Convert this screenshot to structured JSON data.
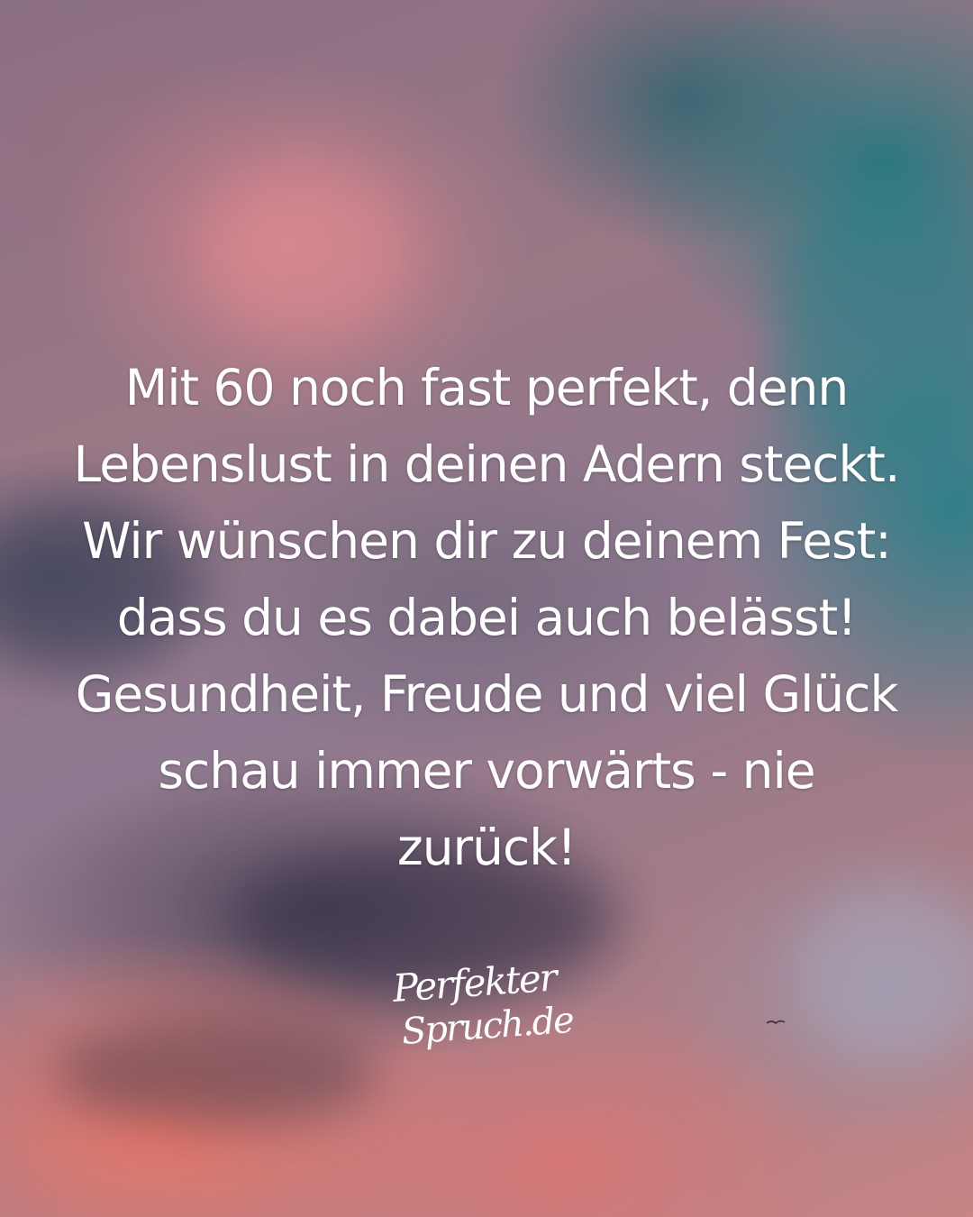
{
  "quote": {
    "lines": [
      "Mit 60 noch fast perfekt, denn",
      "Lebenslust in deinen Adern steckt.",
      "Wir wünschen dir zu deinem Fest:",
      "dass du es dabei auch belässt!",
      "Gesundheit, Freude und viel Glück",
      "schau immer vorwärts - nie",
      "zurück!"
    ]
  },
  "logo": {
    "line1": "Perfekter",
    "line2": "Spruch.de"
  },
  "colors": {
    "text": "#ffffff",
    "sky_teal": "#2a7880",
    "sky_pink": "#d6848c",
    "sky_coral": "#ec786a",
    "cloud_dark": "#423e54"
  },
  "icons": {
    "bird": "bird-icon"
  }
}
